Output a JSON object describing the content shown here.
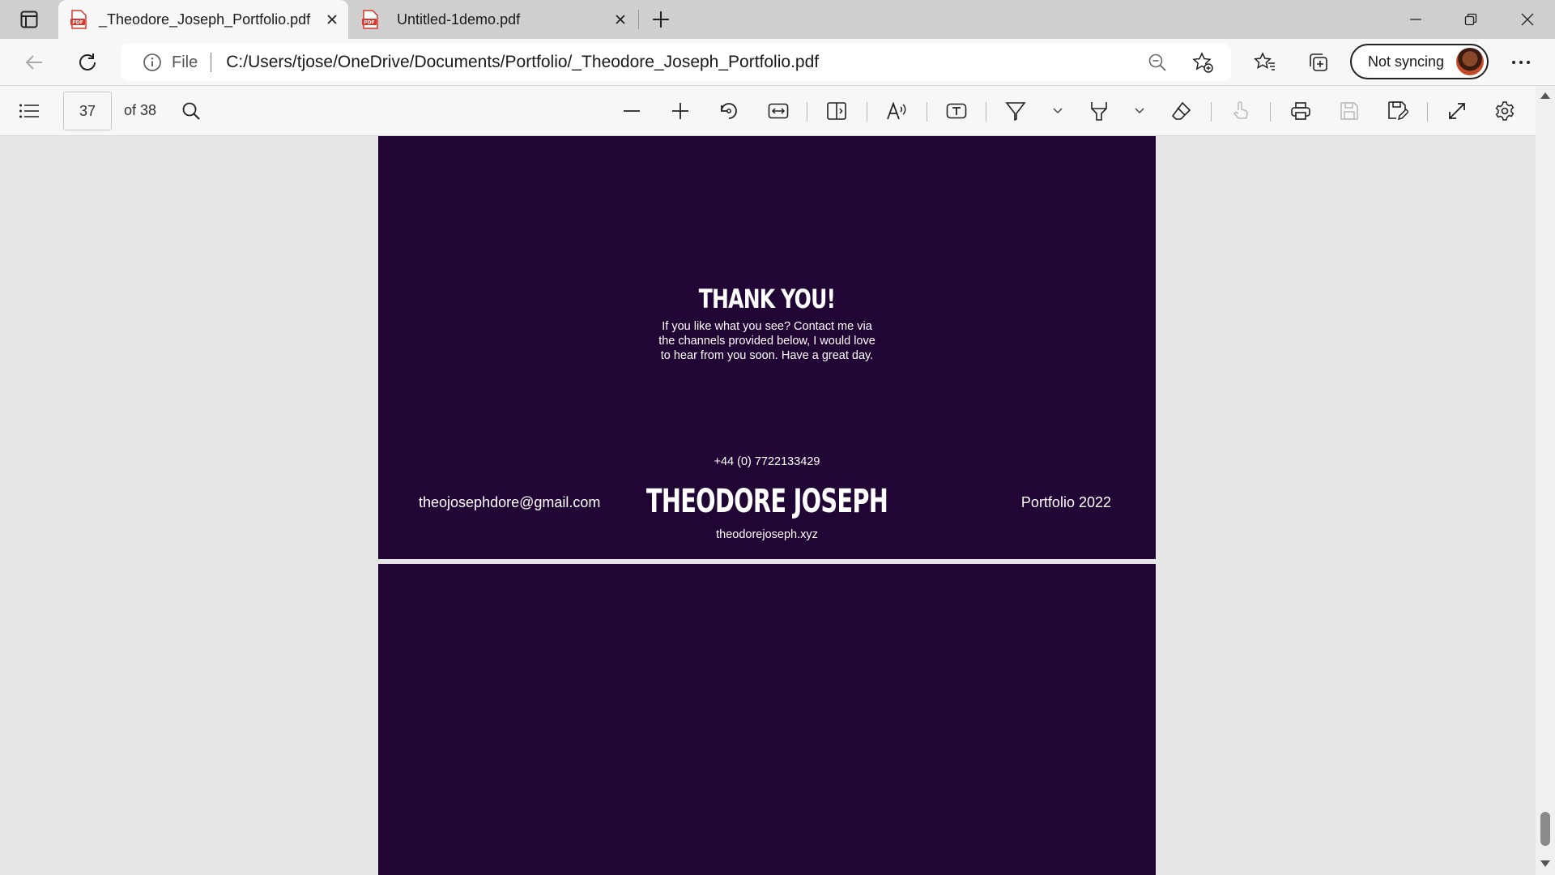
{
  "tabs": [
    {
      "title": "_Theodore_Joseph_Portfolio.pdf",
      "active": true
    },
    {
      "title": "Untitled-1demo.pdf",
      "active": false
    }
  ],
  "address": {
    "scheme_label": "File",
    "url": "C:/Users/tjose/OneDrive/Documents/Portfolio/_Theodore_Joseph_Portfolio.pdf"
  },
  "profile": {
    "sync_label": "Not syncing"
  },
  "pdf_toolbar": {
    "current_page": "37",
    "total_pages_label": "of 38"
  },
  "page_content": {
    "title": "THANK YOU!",
    "body": "If you like what you see? Contact me via the channels provided below, I would love to hear from you soon. Have a great day.",
    "phone": "+44 (0) 7722133429",
    "email": "theojosephdore@gmail.com",
    "name": "THEODORE JOSEPH",
    "portfolio": "Portfolio 2022",
    "website": "theodorejoseph.xyz"
  },
  "colors": {
    "page_background": "#200535",
    "viewer_background": "#e6e6e6",
    "tabstrip_background": "#cfcfcf",
    "pdf_icon_red": "#d9352a"
  }
}
